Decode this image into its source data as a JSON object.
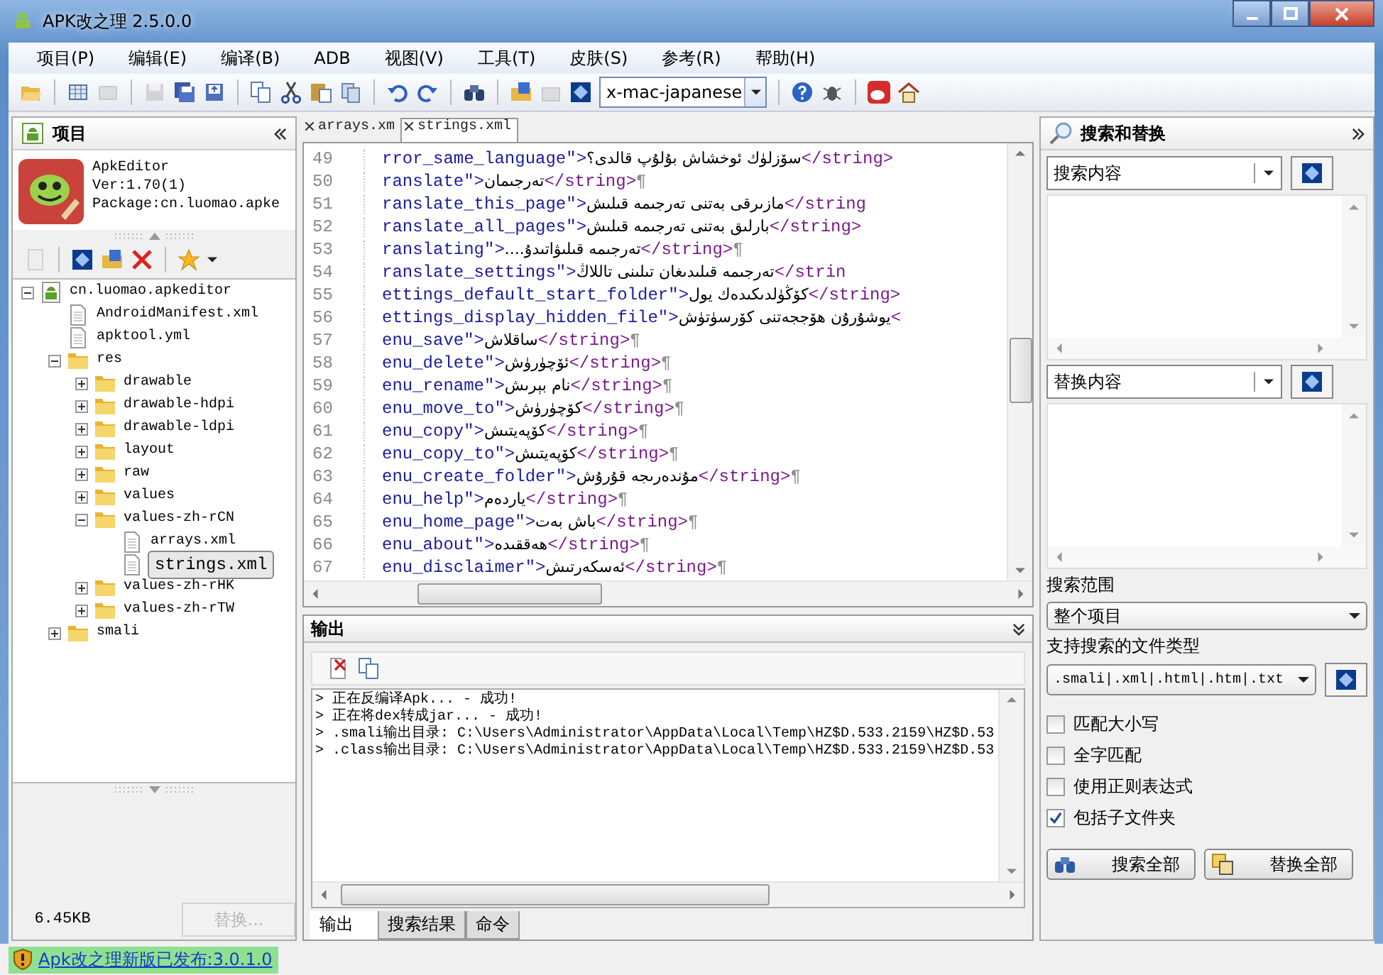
{
  "window": {
    "title": "APK改之理 2.5.0.0"
  },
  "menu": [
    "项目(P)",
    "编辑(E)",
    "编译(B)",
    "ADB",
    "视图(V)",
    "工具(T)",
    "皮肤(S)",
    "参考(R)",
    "帮助(H)"
  ],
  "toolbar": {
    "encoding": "x-mac-japanese"
  },
  "project_panel": {
    "title": "项目",
    "app": {
      "name": "ApkEditor",
      "version": "Ver:1.70(1)",
      "package": "Package:cn.luomao.apke"
    },
    "tree": [
      {
        "label": "cn.luomao.apkeditor",
        "kind": "project",
        "expanded": true,
        "selected": false,
        "children": [
          {
            "label": "AndroidManifest.xml",
            "kind": "file",
            "selected": false
          },
          {
            "label": "apktool.yml",
            "kind": "file",
            "selected": false
          },
          {
            "label": "res",
            "kind": "folder",
            "expanded": true,
            "selected": false,
            "children": [
              {
                "label": "drawable",
                "kind": "folder",
                "expanded": false,
                "selected": false
              },
              {
                "label": "drawable-hdpi",
                "kind": "folder",
                "expanded": false,
                "selected": false
              },
              {
                "label": "drawable-ldpi",
                "kind": "folder",
                "expanded": false,
                "selected": false
              },
              {
                "label": "layout",
                "kind": "folder",
                "expanded": false,
                "selected": false
              },
              {
                "label": "raw",
                "kind": "folder",
                "expanded": false,
                "selected": false
              },
              {
                "label": "values",
                "kind": "folder",
                "expanded": false,
                "selected": false
              },
              {
                "label": "values-zh-rCN",
                "kind": "folder",
                "expanded": true,
                "selected": false,
                "children": [
                  {
                    "label": "arrays.xml",
                    "kind": "file",
                    "selected": false
                  },
                  {
                    "label": "strings.xml",
                    "kind": "file",
                    "selected": true
                  }
                ]
              },
              {
                "label": "values-zh-rHK",
                "kind": "folder",
                "expanded": false,
                "selected": false
              },
              {
                "label": "values-zh-rTW",
                "kind": "folder",
                "expanded": false,
                "selected": false
              }
            ]
          },
          {
            "label": "smali",
            "kind": "folder",
            "expanded": false,
            "selected": false
          }
        ]
      }
    ],
    "size": "6.45KB",
    "replace_button": {
      "label": "替换...",
      "disabled": true
    }
  },
  "editor": {
    "tabs": [
      {
        "label": "arrays.xm",
        "selected": false
      },
      {
        "label": "strings.xml",
        "selected": true
      }
    ],
    "pilcrow": "¶",
    "lines": [
      {
        "num": "49",
        "key": "rror_same_language\">",
        "value": "سۆزلۈك ئوخشاش بۇلۇپ قالدى؟",
        "close": "</string>",
        "eol": false
      },
      {
        "num": "50",
        "key": "ranslate\">",
        "value": "تەرجىمان",
        "close": "</string>",
        "eol": true
      },
      {
        "num": "51",
        "key": "ranslate_this_page\">",
        "value": "مازىرقى بەتنى تەرجىمە قىلىش",
        "close": "</string",
        "eol": false
      },
      {
        "num": "52",
        "key": "ranslate_all_pages\">",
        "value": "بارلىق بەتنى تەرجىمە قىلىش",
        "close": "</string>",
        "eol": false
      },
      {
        "num": "53",
        "key": "ranslating\">",
        "value": "تەرجىمە قىلىۋاتىدۇ....",
        "close": "</string>",
        "eol": true
      },
      {
        "num": "54",
        "key": "ranslate_settings\">",
        "value": "تەرجىمە قىلىدىغان تىلىنى تاللاڭ",
        "close": "</strin",
        "eol": false
      },
      {
        "num": "55",
        "key": "ettings_default_start_folder\">",
        "value": "كۆڭۈلدىكىدەك يول",
        "close": "</string>",
        "eol": false
      },
      {
        "num": "56",
        "key": "ettings_display_hidden_file\">",
        "value": "يوشۇرۇن ھۆججەتنى كۆرسۈتۈش",
        "close": "<",
        "eol": false
      },
      {
        "num": "57",
        "key": "enu_save\">",
        "value": "ساقلاش",
        "close": "</string>",
        "eol": true
      },
      {
        "num": "58",
        "key": "enu_delete\">",
        "value": "ئۆچۈرۈش",
        "close": "</string>",
        "eol": true
      },
      {
        "num": "59",
        "key": "enu_rename\">",
        "value": "نام بېرىش",
        "close": "</string>",
        "eol": true
      },
      {
        "num": "60",
        "key": "enu_move_to\">",
        "value": "كۆچۈرۈش",
        "close": "</string>",
        "eol": true
      },
      {
        "num": "61",
        "key": "enu_copy\">",
        "value": "كۆپەيتىش",
        "close": "</string>",
        "eol": true
      },
      {
        "num": "62",
        "key": "enu_copy_to\">",
        "value": "كۆپەيتىش",
        "close": "</string>",
        "eol": true
      },
      {
        "num": "63",
        "key": "enu_create_folder\">",
        "value": "مۇندەرىجە قۇرۇش",
        "close": "</string>",
        "eol": true
      },
      {
        "num": "64",
        "key": "enu_help\">",
        "value": "ياردەم",
        "close": "</string>",
        "eol": true
      },
      {
        "num": "65",
        "key": "enu_home_page\">",
        "value": "باش بەت",
        "close": "</string>",
        "eol": true
      },
      {
        "num": "66",
        "key": "enu_about\">",
        "value": "ھەققىدە",
        "close": "</string>",
        "eol": true
      },
      {
        "num": "67",
        "key": "enu_disclaimer\">",
        "value": "ئەسكەرتىش",
        "close": "</string>",
        "eol": true
      }
    ]
  },
  "output": {
    "title": "输出",
    "lines": [
      "> 正在反编译Apk...  - 成功!",
      "> 正在将dex转成jar...  - 成功!",
      "> .smali输出目录: C:\\Users\\Administrator\\AppData\\Local\\Temp\\HZ$D.533.2159\\HZ$D.53",
      "> .class输出目录: C:\\Users\\Administrator\\AppData\\Local\\Temp\\HZ$D.533.2159\\HZ$D.53"
    ],
    "tabs": [
      {
        "label": "输出",
        "selected": true
      },
      {
        "label": "搜索结果",
        "selected": false
      },
      {
        "label": "命令",
        "selected": false
      }
    ]
  },
  "search_panel": {
    "title": "搜索和替换",
    "search_placeholder": "搜索内容",
    "replace_placeholder": "替换内容",
    "scope_label": "搜索范围",
    "scope": "整个项目",
    "types_label": "支持搜索的文件类型",
    "types": ".smali|.xml|.html|.htm|.txt",
    "options": [
      {
        "label": "匹配大小写",
        "checked": false
      },
      {
        "label": "全字匹配",
        "checked": false
      },
      {
        "label": "使用正则表达式",
        "checked": false
      },
      {
        "label": "包括子文件夹",
        "checked": true
      }
    ],
    "search_all": "搜索全部",
    "replace_all": "替换全部"
  },
  "status_bar": {
    "link": "Apk改之理新版已发布:3.0.1.0"
  }
}
